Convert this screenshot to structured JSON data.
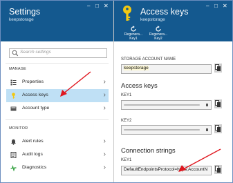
{
  "colors": {
    "header_bg": "#14598f",
    "selected_bg": "#bfe0f5",
    "arrow": "#e0171f",
    "key_yellow": "#f2c811"
  },
  "left_blade": {
    "title": "Settings",
    "subtitle": "keepstorage",
    "search_placeholder": "Search settings",
    "sections": [
      {
        "title": "MANAGE",
        "items": [
          {
            "label": "Properties",
            "icon": "properties-icon"
          },
          {
            "label": "Access keys",
            "icon": "key-icon",
            "selected": true
          },
          {
            "label": "Account type",
            "icon": "account-type-icon"
          }
        ]
      },
      {
        "title": "MONITOR",
        "items": [
          {
            "label": "Alert rules",
            "icon": "bell-icon"
          },
          {
            "label": "Audit logs",
            "icon": "audit-logs-icon"
          },
          {
            "label": "Diagnostics",
            "icon": "diagnostics-icon"
          }
        ]
      }
    ]
  },
  "right_blade": {
    "title": "Access keys",
    "subtitle": "keepstorage",
    "regen_key1_line1": "Regenera...",
    "regen_key1_line2": "Key1",
    "regen_key2_line1": "Regenera...",
    "regen_key2_line2": "Key2",
    "storage_account_label": "STORAGE ACCOUNT NAME",
    "storage_account_value": "keepstorage",
    "access_keys_heading": "Access keys",
    "key1_label": "KEY1",
    "key2_label": "KEY2",
    "connection_strings_heading": "Connection strings",
    "conn_key1_label": "KEY1",
    "conn_key1_value": "DefaultEndpointsProtocol=https;AccountN"
  }
}
